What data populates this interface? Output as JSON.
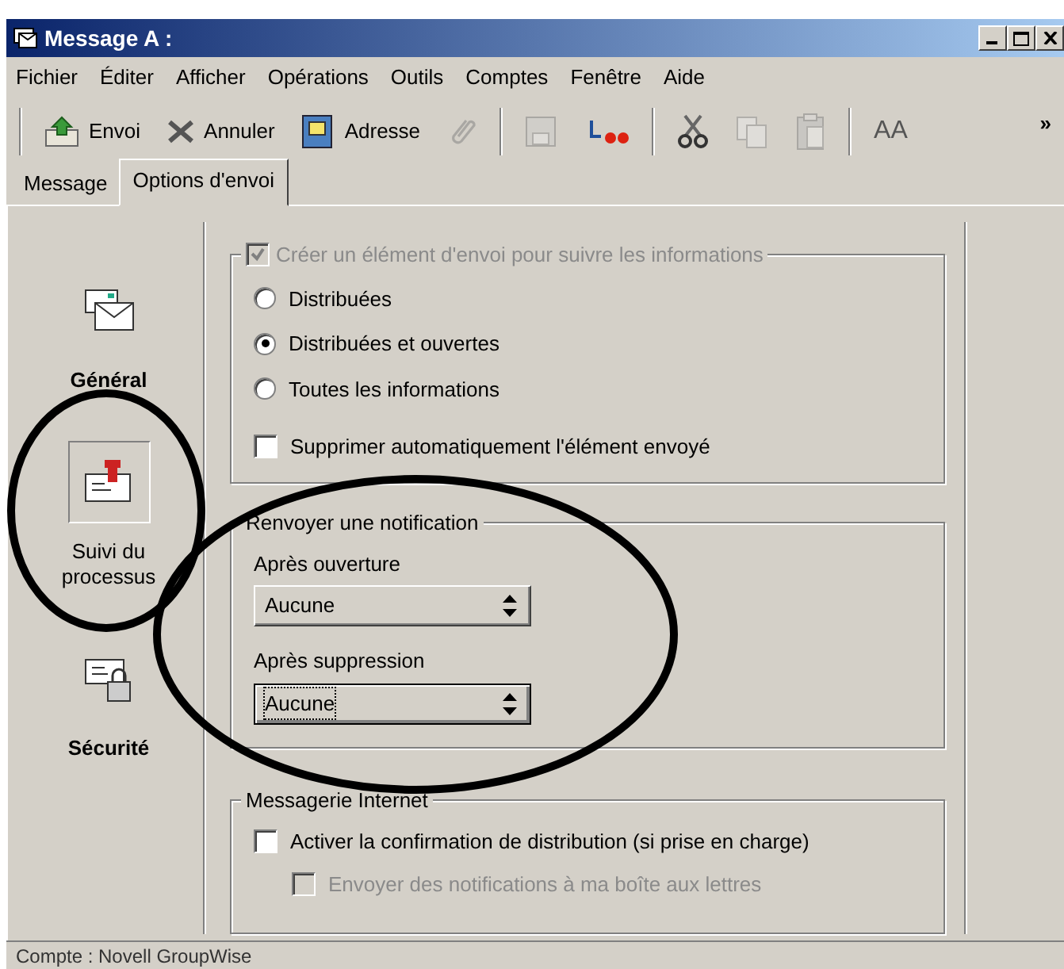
{
  "window": {
    "title": "Message A :"
  },
  "menu": [
    "Fichier",
    "Éditer",
    "Afficher",
    "Opérations",
    "Outils",
    "Comptes",
    "Fenêtre",
    "Aide"
  ],
  "toolbar": [
    {
      "kind": "button",
      "label": "Envoi",
      "disabled": false
    },
    {
      "kind": "button",
      "label": "Annuler",
      "disabled": false
    },
    {
      "kind": "button",
      "label": "Adresse",
      "disabled": false
    },
    {
      "kind": "icon",
      "disabled": true
    },
    {
      "kind": "separator"
    },
    {
      "kind": "icon",
      "disabled": true
    },
    {
      "kind": "icon",
      "disabled": false
    },
    {
      "kind": "separator"
    },
    {
      "kind": "icon",
      "disabled": false
    },
    {
      "kind": "icon",
      "disabled": true
    },
    {
      "kind": "icon",
      "disabled": true
    },
    {
      "kind": "separator"
    },
    {
      "kind": "glyph",
      "label": "AA",
      "disabled": false
    }
  ],
  "toolbar_overflow": "»",
  "tabs": [
    {
      "label": "Message",
      "selected": false
    },
    {
      "label": "Options d'envoi",
      "selected": true
    }
  ],
  "sections": [
    {
      "label": "Général",
      "selected": false
    },
    {
      "label": "Suivi du processus",
      "selected": true
    },
    {
      "label": "Sécurité",
      "selected": false
    }
  ],
  "tracking": {
    "label": "Créer un élément d'envoi pour suivre les informations",
    "checked": true,
    "disabled": true,
    "options": [
      {
        "label": "Distribuées",
        "selected": false
      },
      {
        "label": "Distribuées et ouvertes",
        "selected": true
      },
      {
        "label": "Toutes les informations",
        "selected": false
      }
    ],
    "auto_delete": {
      "label": "Supprimer automatiquement l'élément envoyé",
      "checked": false
    }
  },
  "notification": {
    "title": "Renvoyer une notification",
    "fields": [
      {
        "label": "Après ouverture",
        "value": "Aucune",
        "focused": false
      },
      {
        "label": "Après suppression",
        "value": "Aucune",
        "focused": true
      }
    ]
  },
  "internet": {
    "title": "Messagerie Internet",
    "options": [
      {
        "label": "Activer la confirmation de distribution (si prise en charge)",
        "checked": false,
        "disabled": false
      },
      {
        "label": "Envoyer des notifications à ma boîte aux lettres",
        "checked": false,
        "disabled": true
      }
    ]
  },
  "status_bar": "Compte : Novell GroupWise",
  "annotations": [
    {
      "kind": "ellipse"
    },
    {
      "kind": "ellipse"
    }
  ]
}
